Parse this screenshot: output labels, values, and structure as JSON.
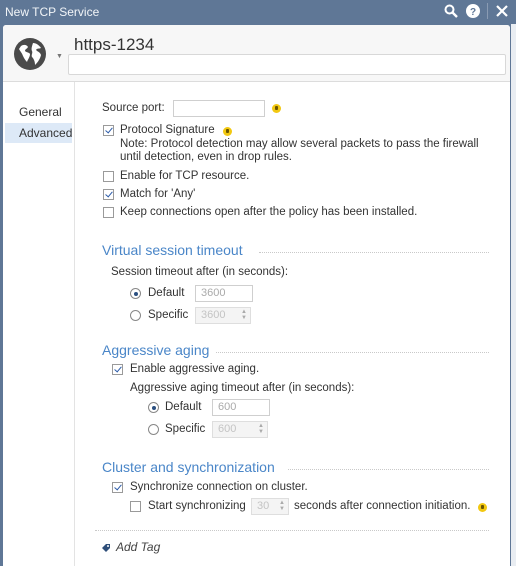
{
  "window": {
    "title": "New TCP Service",
    "icons": [
      "search-icon",
      "help-icon",
      "close-icon"
    ]
  },
  "header": {
    "object_icon": "globe-icon",
    "name": "https-1234",
    "comment_placeholder": "",
    "comment_value": ""
  },
  "sidebar": {
    "items": [
      {
        "label": "General",
        "active": false
      },
      {
        "label": "Advanced",
        "active": true
      }
    ]
  },
  "advanced": {
    "source_port": {
      "label": "Source port:",
      "value": ""
    },
    "protocol_signature": {
      "label": "Protocol Signature",
      "checked": true,
      "note_line1": "Note: Protocol detection may allow several packets to pass the firewall",
      "note_line2": "until detection, even in drop rules."
    },
    "enable_tcp_resource": {
      "label": "Enable for TCP resource.",
      "checked": false
    },
    "match_any": {
      "label": "Match for 'Any'",
      "checked": true
    },
    "keep_connections": {
      "label": "Keep connections open after the policy has been installed.",
      "checked": false
    }
  },
  "virtual_session": {
    "title": "Virtual session timeout",
    "subtitle": "Session timeout after (in seconds):",
    "default_label": "Default",
    "default_value": "3600",
    "specific_label": "Specific",
    "specific_value": "3600",
    "selected": "Default"
  },
  "aggressive_aging": {
    "title": "Aggressive aging",
    "enable_label": "Enable aggressive aging.",
    "enable_checked": true,
    "subtitle": "Aggressive aging timeout after (in seconds):",
    "default_label": "Default",
    "default_value": "600",
    "specific_label": "Specific",
    "specific_value": "600",
    "selected": "Default"
  },
  "cluster": {
    "title": "Cluster and synchronization",
    "sync_label": "Synchronize connection on cluster.",
    "sync_checked": true,
    "start_label": "Start synchronizing",
    "start_checked": false,
    "start_value": "30",
    "after_label": "seconds after connection initiation."
  },
  "footer": {
    "add_tag_label": "Add Tag"
  },
  "colors": {
    "titlebar": "#5f7796",
    "section_title": "#4a86c8",
    "active_sidebar": "#dde9f7",
    "tip_icon": "#f2c811"
  }
}
